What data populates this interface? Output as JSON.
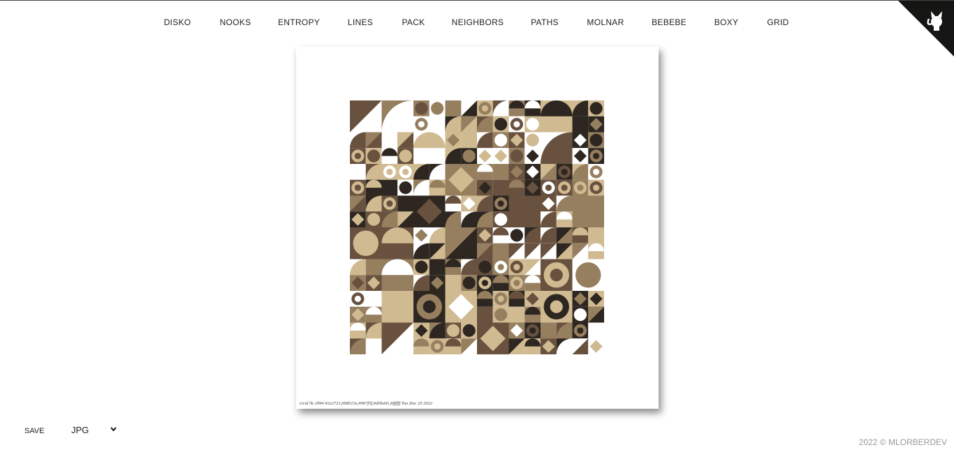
{
  "nav": {
    "items": [
      "DISKO",
      "NOOKS",
      "ENTROPY",
      "LINES",
      "PACK",
      "NEIGHBORS",
      "PATHS",
      "MOLNAR",
      "BEBEBE",
      "BOXY",
      "GRID"
    ]
  },
  "corner": {
    "icon": "github-octocat-icon"
  },
  "canvas": {
    "caption": "Grid № 2994 #2e2721,#68513e,#967f5f,#d0ba91,#ffffff Tue Dec 20 2022",
    "palette": [
      "#2e2721",
      "#68513e",
      "#967f5f",
      "#d0ba91",
      "#ffffff"
    ]
  },
  "controls": {
    "save_label": "SAVE",
    "format_value": "JPG"
  },
  "footer": {
    "copyright": "2022 © MLORBERDEV"
  }
}
